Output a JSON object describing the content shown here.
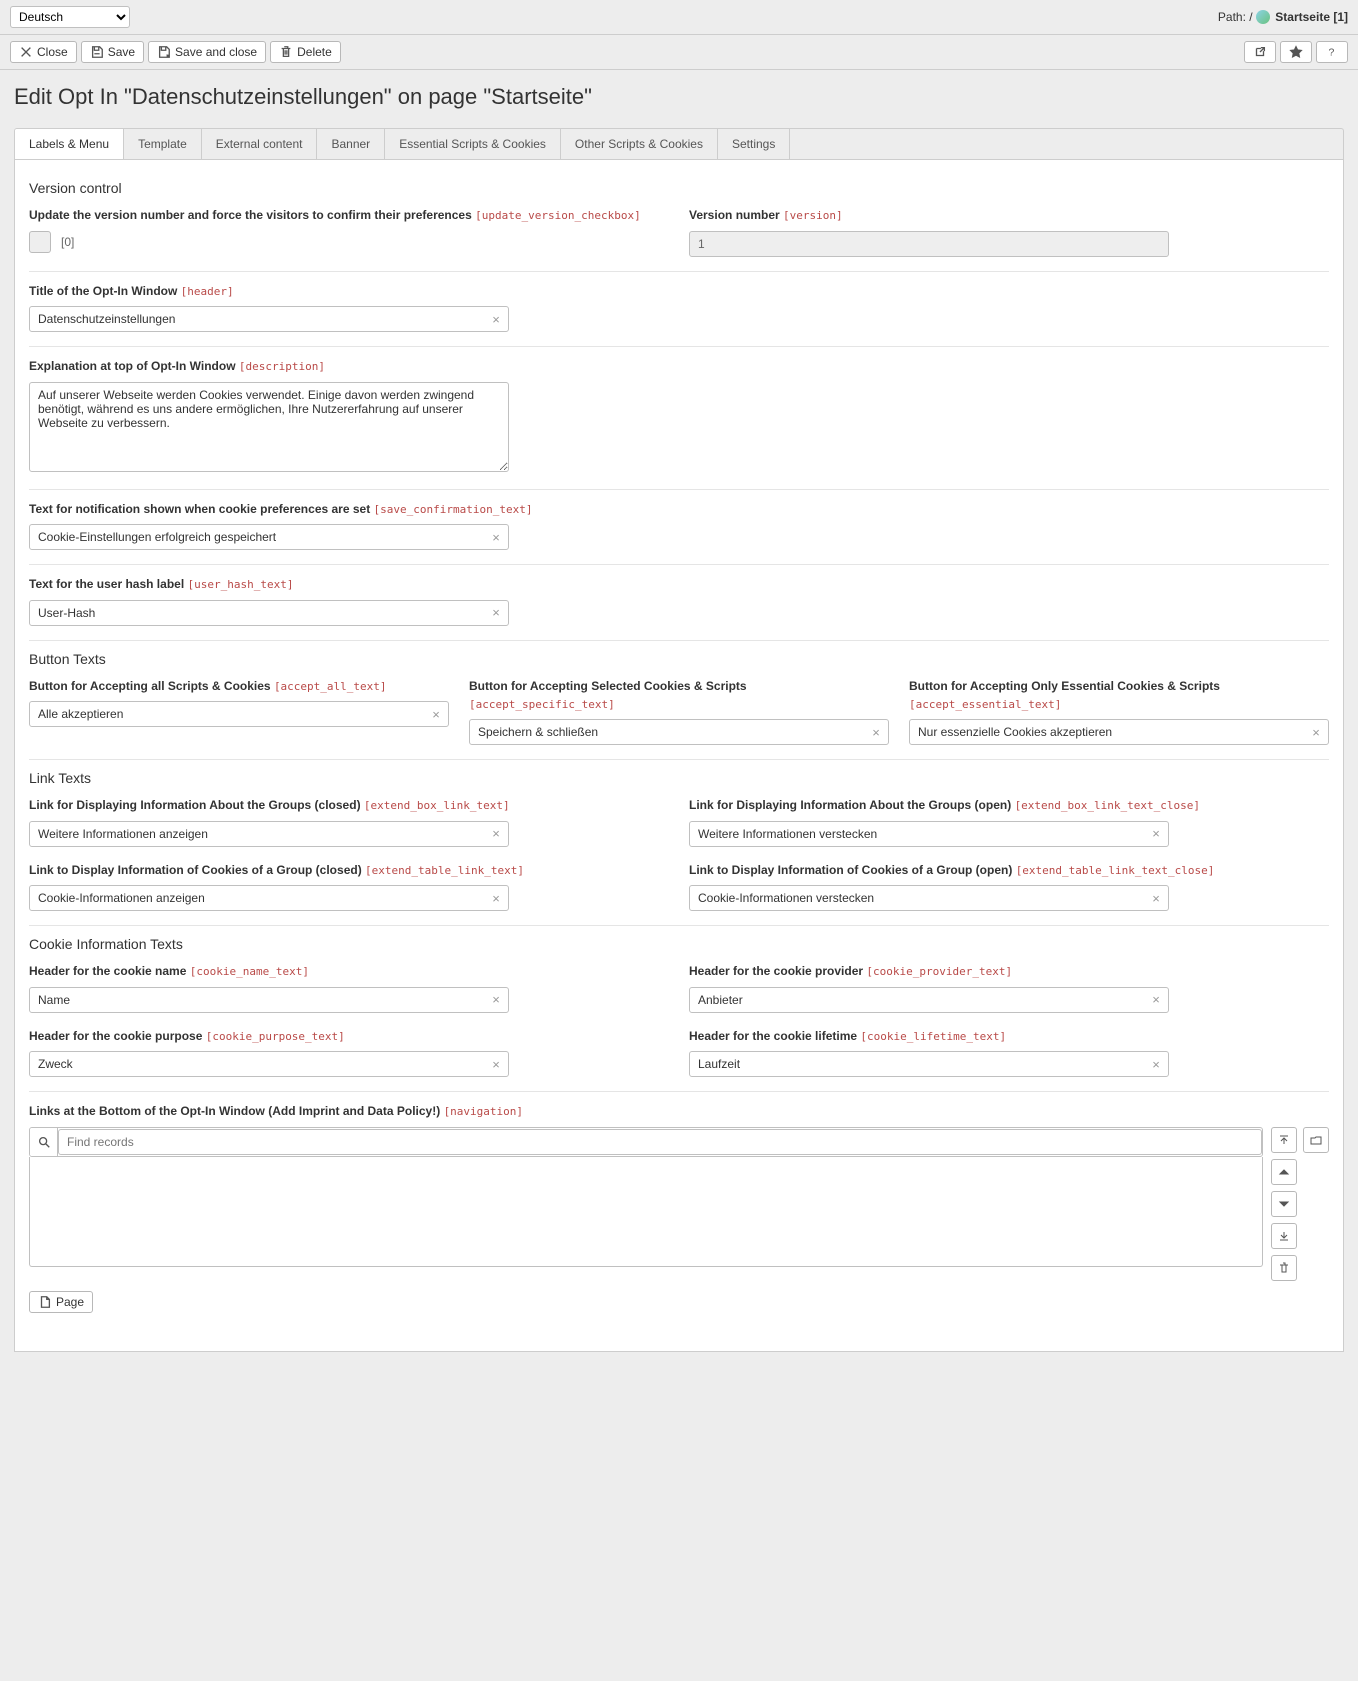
{
  "topbar": {
    "language": "Deutsch",
    "path_prefix": "Path: /",
    "path_page": "Startseite [1]"
  },
  "docheader": {
    "close": "Close",
    "save": "Save",
    "save_close": "Save and close",
    "delete": "Delete"
  },
  "page_title": "Edit Opt In \"Datenschutzeinstellungen\" on page \"Startseite\"",
  "tabs": {
    "labels_menu": "Labels & Menu",
    "template": "Template",
    "external": "External content",
    "banner": "Banner",
    "essential": "Essential Scripts & Cookies",
    "other": "Other Scripts & Cookies",
    "settings": "Settings"
  },
  "sections": {
    "version_control": "Version control",
    "button_texts": "Button Texts",
    "link_texts": "Link Texts",
    "cookie_info": "Cookie Information Texts"
  },
  "fields": {
    "update_version": {
      "label": "Update the version number and force the visitors to confirm their preferences",
      "tech": "[update_version_checkbox]",
      "value": "[0]"
    },
    "version_number": {
      "label": "Version number",
      "tech": "[version]",
      "value": "1"
    },
    "header": {
      "label": "Title of the Opt-In Window",
      "tech": "[header]",
      "value": "Datenschutzeinstellungen"
    },
    "description": {
      "label": "Explanation at top of Opt-In Window",
      "tech": "[description]",
      "value": "Auf unserer Webseite werden Cookies verwendet. Einige davon werden zwingend benötigt, während es uns andere ermöglichen, Ihre Nutzererfahrung auf unserer Webseite zu verbessern."
    },
    "save_confirm": {
      "label": "Text for notification shown when cookie preferences are set",
      "tech": "[save_confirmation_text]",
      "value": "Cookie-Einstellungen erfolgreich gespeichert"
    },
    "user_hash": {
      "label": "Text for the user hash label",
      "tech": "[user_hash_text]",
      "value": "User-Hash"
    },
    "accept_all": {
      "label": "Button for Accepting all Scripts & Cookies",
      "tech": "[accept_all_text]",
      "value": "Alle akzeptieren"
    },
    "accept_specific": {
      "label": "Button for Accepting Selected Cookies & Scripts",
      "tech": "[accept_specific_text]",
      "value": "Speichern & schließen"
    },
    "accept_essential": {
      "label": "Button for Accepting Only Essential Cookies & Scripts",
      "tech": "[accept_essential_text]",
      "value": "Nur essenzielle Cookies akzeptieren"
    },
    "extend_box_link": {
      "label": "Link for Displaying Information About the Groups (closed)",
      "tech": "[extend_box_link_text]",
      "value": "Weitere Informationen anzeigen"
    },
    "extend_box_link_close": {
      "label": "Link for Displaying Information About the Groups (open)",
      "tech": "[extend_box_link_text_close]",
      "value": "Weitere Informationen verstecken"
    },
    "extend_table_link": {
      "label": "Link to Display Information of Cookies of a Group (closed)",
      "tech": "[extend_table_link_text]",
      "value": "Cookie-Informationen anzeigen"
    },
    "extend_table_link_close": {
      "label": "Link to Display Information of Cookies of a Group (open)",
      "tech": "[extend_table_link_text_close]",
      "value": "Cookie-Informationen verstecken"
    },
    "cookie_name": {
      "label": "Header for the cookie name",
      "tech": "[cookie_name_text]",
      "value": "Name"
    },
    "cookie_provider": {
      "label": "Header for the cookie provider",
      "tech": "[cookie_provider_text]",
      "value": "Anbieter"
    },
    "cookie_purpose": {
      "label": "Header for the cookie purpose",
      "tech": "[cookie_purpose_text]",
      "value": "Zweck"
    },
    "cookie_lifetime": {
      "label": "Header for the cookie lifetime",
      "tech": "[cookie_lifetime_text]",
      "value": "Laufzeit"
    },
    "navigation": {
      "label": "Links at the Bottom of the Opt-In Window (Add Imprint and Data Policy!)",
      "tech": "[navigation]",
      "placeholder": "Find records"
    }
  },
  "buttons": {
    "page": "Page"
  }
}
